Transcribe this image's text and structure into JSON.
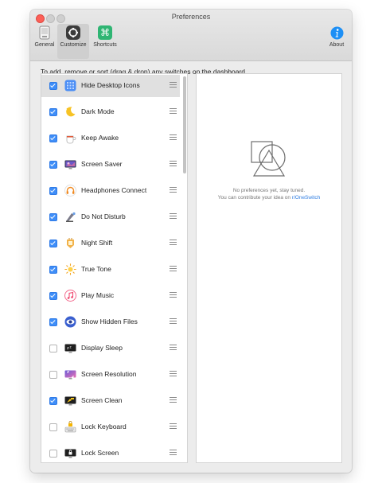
{
  "window": {
    "title": "Preferences"
  },
  "toolbar": {
    "general_label": "General",
    "customize_label": "Customize",
    "shortcuts_label": "Shortcuts",
    "about_label": "About"
  },
  "instruction": "To add, remove or sort (drag & drop) any switches on the dashboard.",
  "switches": [
    {
      "label": "Hide Desktop Icons",
      "checked": true,
      "selected": true,
      "icon": "hide-desktop-icon"
    },
    {
      "label": "Dark Mode",
      "checked": true,
      "icon": "dark-mode-icon"
    },
    {
      "label": "Keep Awake",
      "checked": true,
      "icon": "keep-awake-icon"
    },
    {
      "label": "Screen Saver",
      "checked": true,
      "icon": "screen-saver-icon"
    },
    {
      "label": "Headphones Connect",
      "checked": true,
      "icon": "headphones-icon"
    },
    {
      "label": "Do Not Disturb",
      "checked": true,
      "icon": "do-not-disturb-icon"
    },
    {
      "label": "Night Shift",
      "checked": true,
      "icon": "night-shift-icon"
    },
    {
      "label": "True Tone",
      "checked": true,
      "icon": "true-tone-icon"
    },
    {
      "label": "Play Music",
      "checked": true,
      "icon": "play-music-icon"
    },
    {
      "label": "Show Hidden Files",
      "checked": true,
      "icon": "show-hidden-files-icon"
    },
    {
      "label": "Display Sleep",
      "checked": false,
      "icon": "display-sleep-icon"
    },
    {
      "label": "Screen Resolution",
      "checked": false,
      "icon": "screen-resolution-icon"
    },
    {
      "label": "Screen Clean",
      "checked": true,
      "icon": "screen-clean-icon"
    },
    {
      "label": "Lock Keyboard",
      "checked": false,
      "icon": "lock-keyboard-icon"
    },
    {
      "label": "Lock Screen",
      "checked": false,
      "icon": "lock-screen-icon"
    }
  ],
  "detail": {
    "empty_line1": "No preferences yet, stay tuned.",
    "empty_line2": "You can contribute your idea on ",
    "empty_link": "r/OneSwitch"
  },
  "colors": {
    "accent": "#3f8ef8",
    "link": "#2f7de1",
    "close": "#fc5f57"
  }
}
